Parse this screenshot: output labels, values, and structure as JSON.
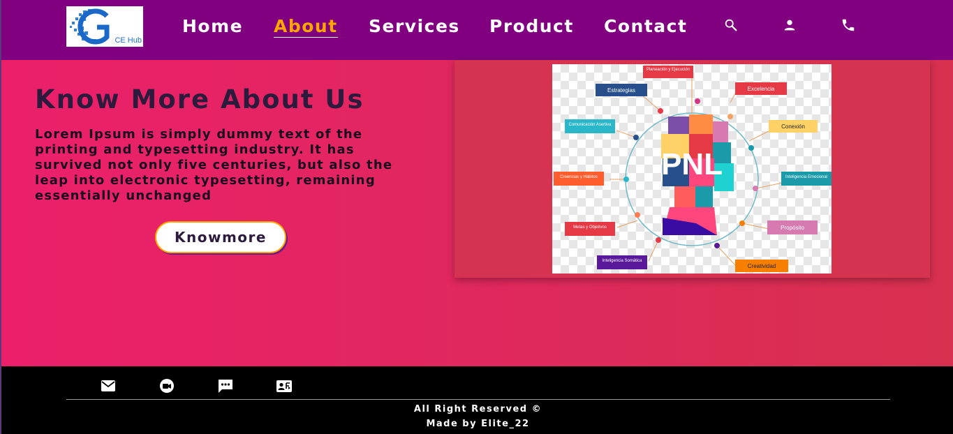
{
  "nav": {
    "logo_text": "CE Hub",
    "links": [
      {
        "label": "Home",
        "active": false
      },
      {
        "label": "About",
        "active": true
      },
      {
        "label": "Services",
        "active": false
      },
      {
        "label": "Product",
        "active": false
      },
      {
        "label": "Contact",
        "active": false
      }
    ],
    "icons": [
      "search-icon",
      "user-icon",
      "phone-icon"
    ]
  },
  "hero": {
    "title": "Know More About Us",
    "text": "Lorem Ipsum is simply dummy text of the printing and typesetting industry. It has survived not only five centuries, but also the leap into electronic typesetting, remaining essentially unchanged",
    "button_label": "Knowmore"
  },
  "pnl_image": {
    "center_label": "PNL",
    "labels": [
      "Planeación y Ejecución",
      "Estrategias",
      "Excelencia",
      "Comunicación Asertiva",
      "Conexión",
      "Creencias y Hábitos",
      "Inteligencia Emocional",
      "Metas y Objetivos",
      "Propósito",
      "Inteligencia Somática",
      "Creatividad"
    ]
  },
  "footer": {
    "icons": [
      "mail-icon",
      "video-call-icon",
      "chat-icon",
      "contact-card-icon"
    ],
    "copyright": "All Right Reserved ©",
    "made_by": "Made by Elite_22"
  },
  "colors": {
    "nav_bg": "#800080",
    "active_link": "#ffa500",
    "hero_start": "#ec1f6b",
    "hero_end": "#d8304f",
    "title": "#2d1b3d",
    "footer_bg": "#000000"
  }
}
